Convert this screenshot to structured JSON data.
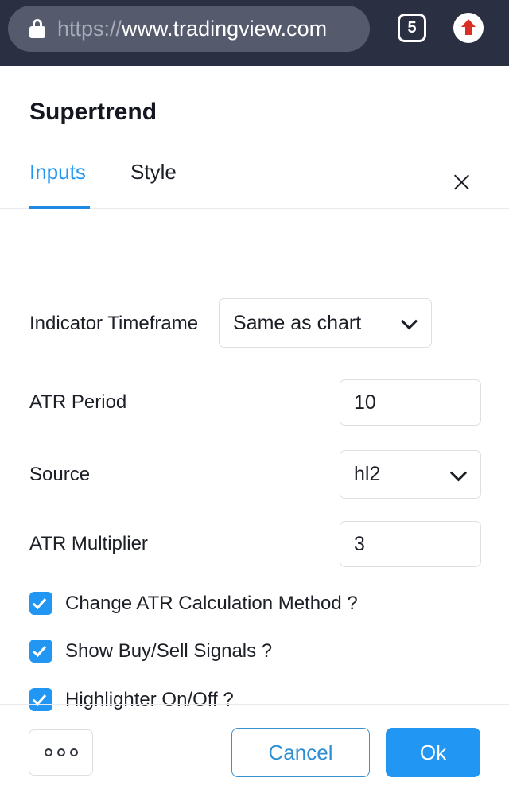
{
  "browser": {
    "lock_icon": "lock-icon",
    "url_scheme": "https://",
    "url_host": "www.tradingview.com",
    "tab_count": "5",
    "upload_icon": "arrow-up-icon"
  },
  "dialog": {
    "title": "Supertrend",
    "close_icon": "close-icon",
    "tabs": [
      {
        "label": "Inputs",
        "active": true
      },
      {
        "label": "Style",
        "active": false
      }
    ],
    "fields": [
      {
        "label": "Indicator Timeframe",
        "type": "select",
        "value": "Same as chart"
      },
      {
        "label": "ATR Period",
        "type": "text",
        "value": "10"
      },
      {
        "label": "Source",
        "type": "select",
        "value": "hl2"
      },
      {
        "label": "ATR Multiplier",
        "type": "text",
        "value": "3"
      }
    ],
    "checkboxes": [
      {
        "label": "Change ATR Calculation Method ?",
        "checked": true
      },
      {
        "label": "Show Buy/Sell Signals ?",
        "checked": true
      },
      {
        "label": "Highlighter On/Off ?",
        "checked": true
      }
    ],
    "footer": {
      "more_label": "more-options",
      "cancel_label": "Cancel",
      "ok_label": "Ok"
    }
  },
  "colors": {
    "accent_blue": "#2196f3",
    "browser_bar": "#2b2f42",
    "url_pill": "#555b6d",
    "upload_red": "#d93025",
    "text_dark": "#1d1f27",
    "border_gray": "#dcdfe3"
  }
}
